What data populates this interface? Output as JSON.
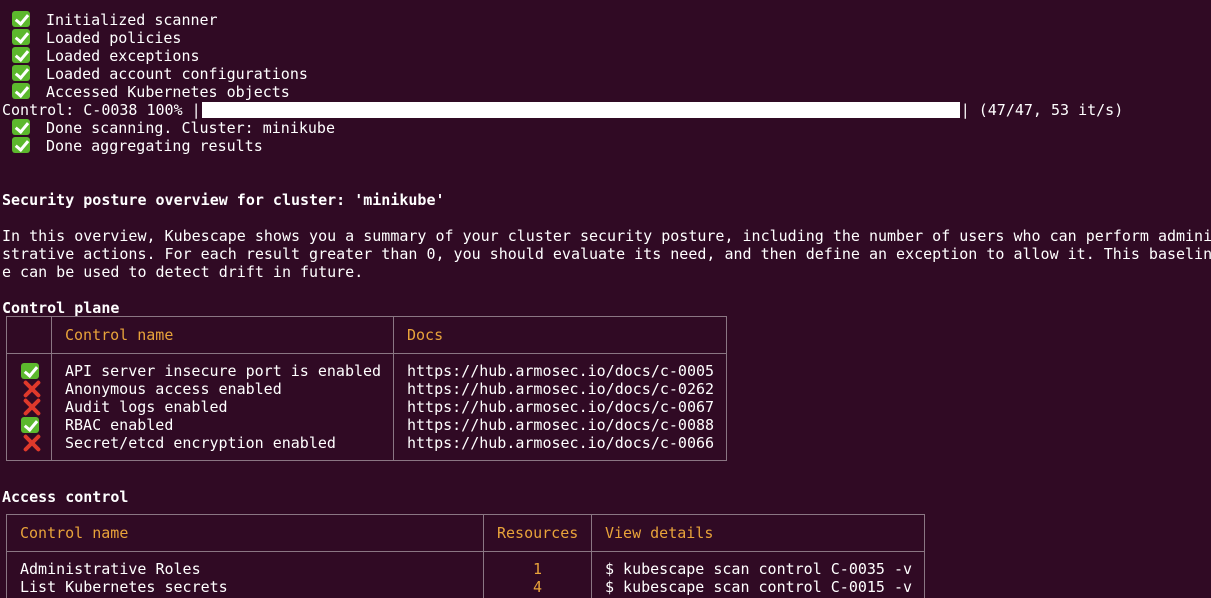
{
  "steps": [
    {
      "status": "ok",
      "text": "Initialized scanner"
    },
    {
      "status": "ok",
      "text": "Loaded policies"
    },
    {
      "status": "ok",
      "text": "Loaded exceptions"
    },
    {
      "status": "ok",
      "text": "Loaded account configurations"
    },
    {
      "status": "ok",
      "text": "Accessed Kubernetes objects"
    }
  ],
  "progress": {
    "label": "Control: C-0038 100% |",
    "end": "| (47/47, 53 it/s)",
    "fraction": 1.0
  },
  "done_steps": [
    {
      "status": "ok",
      "text": "Done scanning. Cluster: minikube"
    },
    {
      "status": "ok",
      "text": "Done aggregating results"
    }
  ],
  "overview": {
    "title": "Security posture overview for cluster: 'minikube'",
    "description_lines": [
      "In this overview, Kubescape shows you a summary of your cluster security posture, including the number of users who can perform admini",
      "strative actions. For each result greater than 0, you should evaluate its need, and then define an exception to allow it. This baselin",
      "e can be used to detect drift in future."
    ]
  },
  "control_plane": {
    "title": "Control plane",
    "headers": {
      "name": "Control name",
      "docs": "Docs"
    },
    "rows": [
      {
        "status": "ok",
        "name": "API server insecure port is enabled",
        "docs": "https://hub.armosec.io/docs/c-0005"
      },
      {
        "status": "fail",
        "name": "Anonymous access enabled",
        "docs": "https://hub.armosec.io/docs/c-0262"
      },
      {
        "status": "fail",
        "name": "Audit logs enabled",
        "docs": "https://hub.armosec.io/docs/c-0067"
      },
      {
        "status": "ok",
        "name": "RBAC enabled",
        "docs": "https://hub.armosec.io/docs/c-0088"
      },
      {
        "status": "fail",
        "name": "Secret/etcd encryption enabled",
        "docs": "https://hub.armosec.io/docs/c-0066"
      }
    ]
  },
  "access_control": {
    "title": "Access control",
    "headers": {
      "name": "Control name",
      "resources": "Resources",
      "details": "View details"
    },
    "rows": [
      {
        "name": "Administrative Roles",
        "resources": "1",
        "details": "$ kubescape scan control C-0035 -v"
      },
      {
        "name": "List Kubernetes secrets",
        "resources": "4",
        "details": "$ kubescape scan control C-0015 -v"
      }
    ]
  },
  "colors": {
    "background": "#300a24",
    "header": "#e8a33a",
    "ok": "#5cb82d",
    "fail": "#e0392b"
  }
}
